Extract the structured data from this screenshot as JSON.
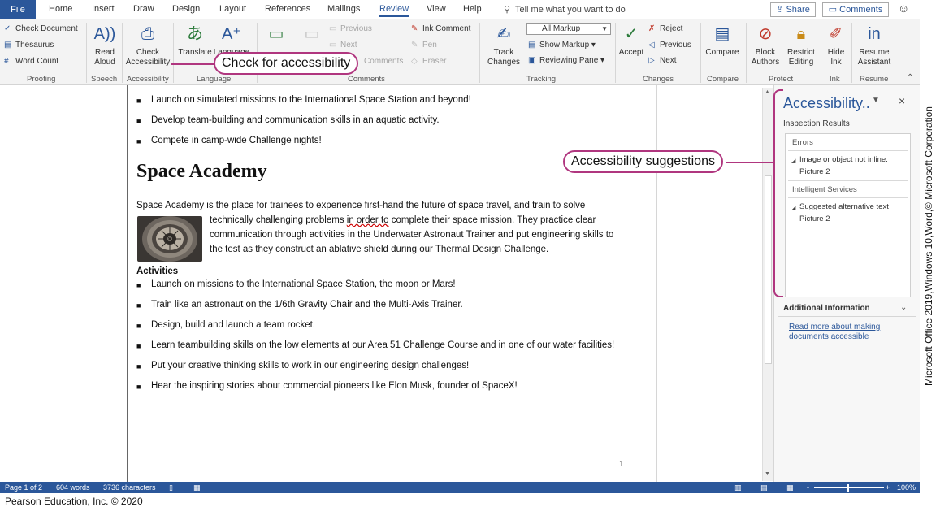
{
  "tabs": {
    "file": "File",
    "items": [
      "Home",
      "Insert",
      "Draw",
      "Design",
      "Layout",
      "References",
      "Mailings",
      "Review",
      "View",
      "Help"
    ],
    "active": "Review",
    "tell_me": "Tell me what you want to do",
    "share": "Share",
    "comments": "Comments"
  },
  "ribbon": {
    "proofing": {
      "check_document": "Check Document",
      "thesaurus": "Thesaurus",
      "word_count": "Word Count",
      "label": "Proofing"
    },
    "speech": {
      "read_aloud_1": "Read",
      "read_aloud_2": "Aloud",
      "label": "Speech"
    },
    "accessibility": {
      "check_1": "Check",
      "check_2": "Accessibility",
      "label": "Accessibility"
    },
    "language": {
      "translate": "Translate",
      "language": "Language",
      "label": "Language"
    },
    "comments": {
      "previous": "Previous",
      "next": "Next",
      "show_comments": "Comments",
      "label": "Comments"
    },
    "ink": {
      "ink_comment": "Ink Comment",
      "pen": "Pen",
      "eraser": "Eraser"
    },
    "tracking": {
      "track_1": "Track",
      "track_2": "Changes",
      "all_markup": "All Markup",
      "show_markup": "Show Markup",
      "reviewing_pane": "Reviewing Pane",
      "label": "Tracking"
    },
    "changes": {
      "accept": "Accept",
      "reject": "Reject",
      "previous": "Previous",
      "next": "Next",
      "label": "Changes"
    },
    "compare": {
      "compare": "Compare",
      "label": "Compare"
    },
    "protect": {
      "block_1": "Block",
      "block_2": "Authors",
      "restrict_1": "Restrict",
      "restrict_2": "Editing",
      "label": "Protect"
    },
    "ink_group": {
      "hide_1": "Hide",
      "hide_2": "Ink",
      "label": "Ink"
    },
    "resume": {
      "resume_1": "Resume",
      "resume_2": "Assistant",
      "label": "Resume"
    }
  },
  "callouts": {
    "check_accessibility": "Check for accessibility",
    "suggestions": "Accessibility suggestions"
  },
  "document": {
    "top_bullets": [
      "Launch on simulated missions to the International Space Station and beyond!",
      "Develop team-building and communication skills in an aquatic activity.",
      "Compete in camp-wide Challenge nights!"
    ],
    "heading": "Space Academy",
    "para_line1": "Space Academy is the place for trainees to experience first-hand the future of space travel, and train to solve",
    "para_line2_pre": "technically challenging problems ",
    "para_line2_squiggle": "in order to",
    "para_line2_post": " complete their space mission. They practice clear",
    "para_line3": "communication through activities in the Underwater Astronaut Trainer and put engineering skills to",
    "para_line4": "the test as they construct an ablative shield during our Thermal Design Challenge.",
    "activities_heading": "Activities",
    "activities": [
      "Launch on missions to the International Space Station, the moon or Mars!",
      "Train like an astronaut on the 1/6th Gravity Chair and the Multi-Axis Trainer.",
      "Design, build and launch a team rocket.",
      "Learn teambuilding skills on the low elements at our Area 51 Challenge Course and in one of our water facilities!",
      "Put your creative thinking skills to work in our engineering design challenges!",
      "Hear the inspiring stories about commercial pioneers like Elon Musk, founder of SpaceX!"
    ],
    "page_number": "1"
  },
  "pane": {
    "title": "Accessibility..",
    "close": "×",
    "inspection_results": "Inspection Results",
    "errors_header": "Errors",
    "error_item": "Image or object not inline.",
    "error_sub": "Picture 2",
    "intelligent_header": "Intelligent Services",
    "intel_item": "Suggested alternative text",
    "intel_sub": "Picture 2",
    "additional_info": "Additional Information",
    "link": "Read more about making documents accessible"
  },
  "status": {
    "page": "Page 1 of 2",
    "words": "604 words",
    "chars": "3736 characters",
    "zoom": "100%",
    "minus": "-",
    "plus": "+"
  },
  "credits": {
    "vertical": "Microsoft Office 2019,Windows 10,Word,© Microsoft Corporation",
    "bottom": "Pearson Education, Inc. © 2020"
  }
}
